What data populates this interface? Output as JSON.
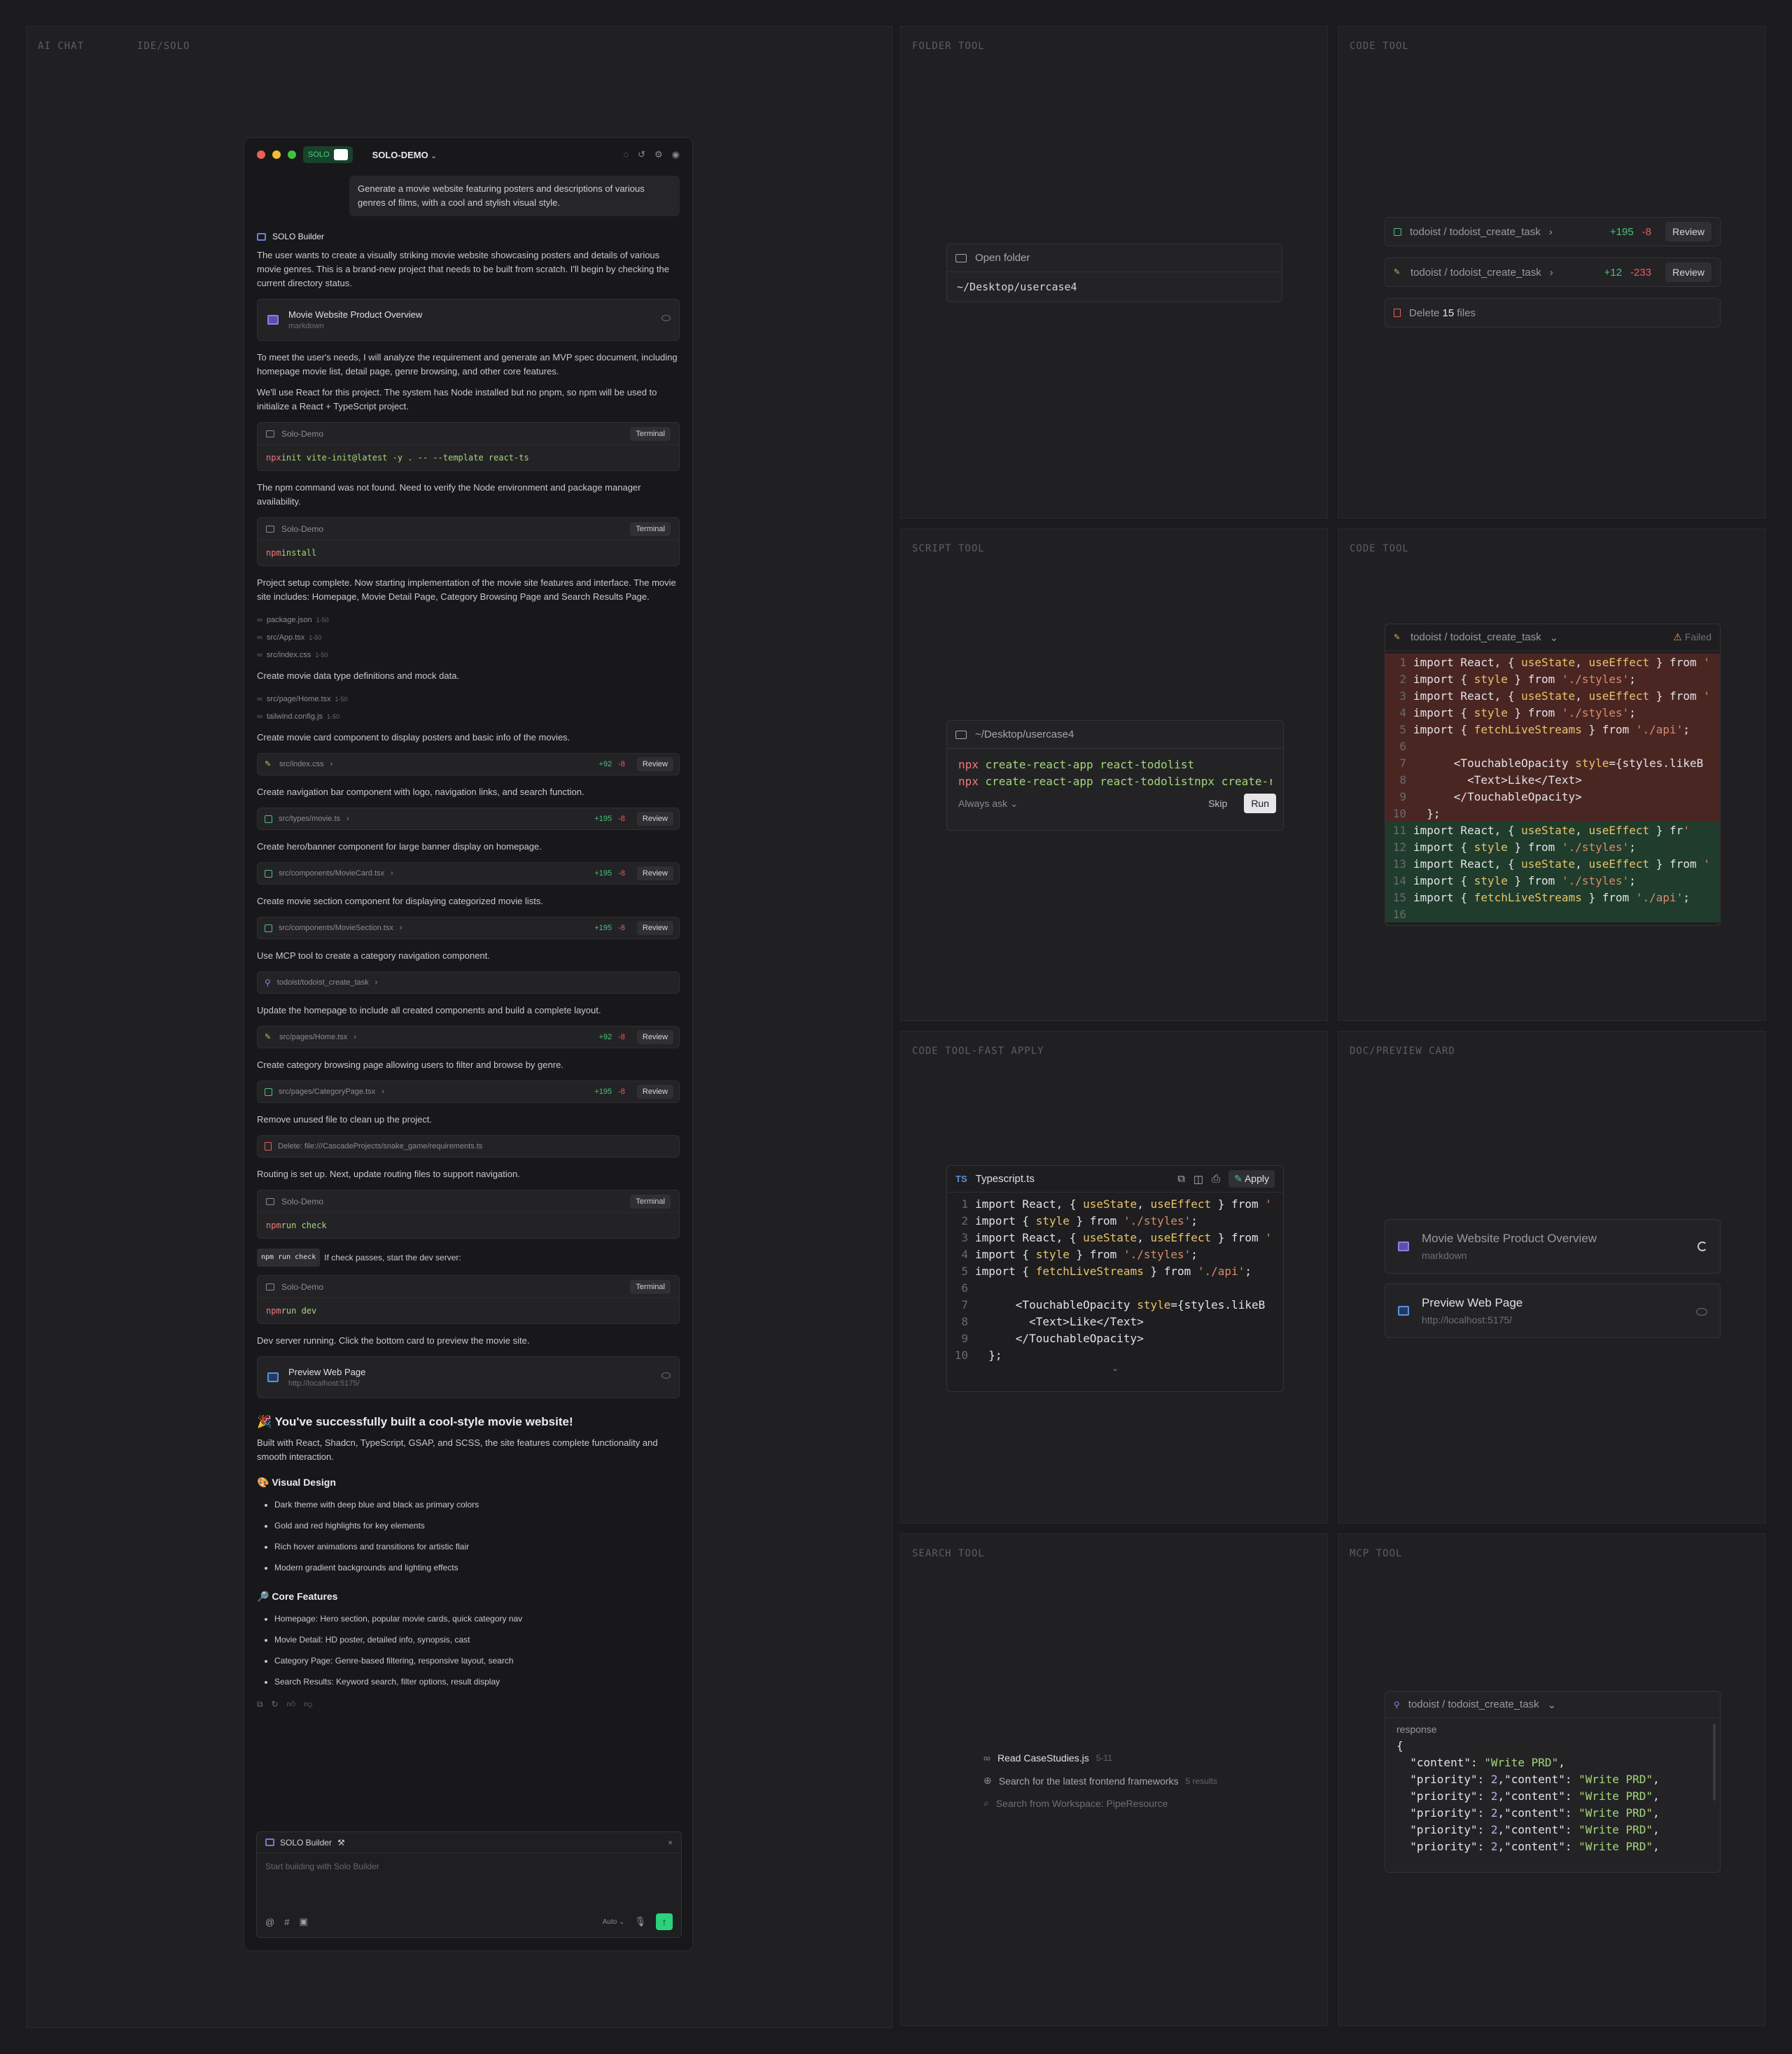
{
  "frames": {
    "ai_chat": "AI CHAT",
    "ide_solo": "IDE/SOLO",
    "folder_tool": "FOLDER TOOL",
    "code_tool_1": "CODE TOOL",
    "script_tool": "SCRIPT TOOL",
    "code_tool_2": "CODE TOOL",
    "code_fast_apply": "CODE TOOL-FAST APPLY",
    "doc_preview": "DOC/PREVIEW CARD",
    "search_tool": "SEARCH TOOL",
    "mcp_tool": "MCP TOOL"
  },
  "chat": {
    "pill": "SOLO",
    "project": "SOLO-DEMO",
    "user_message": "Generate a movie website featuring posters and descriptions of various genres of films, with a cool and stylish visual style.",
    "builder_name": "SOLO Builder",
    "p1": "The user wants to create a visually striking movie website showcasing posters and details of various movie genres. This is a brand-new project that needs to be built from scratch. I'll begin by checking the current directory status.",
    "doc_card": {
      "title": "Movie Website Product Overview",
      "sub": "markdown"
    },
    "p2": "To meet the user's needs, I will analyze the requirement and generate an MVP spec document, including homepage movie list, detail page, genre browsing, and other core features.",
    "p3": "We'll use React for this project. The system has Node installed but no pnpm, so npm will be used to initialize a React + TypeScript project.",
    "term1": {
      "name": "Solo-Demo",
      "btn": "Terminal",
      "cmd": "npx",
      "args": " init vite-init@latest -y . -- --template react-ts"
    },
    "p4": "The npm command was not found. Need to verify the Node environment and package manager availability.",
    "term2": {
      "name": "Solo-Demo",
      "btn": "Terminal",
      "cmd": "npm",
      "args": " install"
    },
    "p5": "Project setup complete. Now starting implementation of the movie site features and interface. The movie site includes: Homepage, Movie Detail Page, Category Browsing Page and Search Results Page.",
    "files1": [
      {
        "name": "package.json",
        "range": "1-50"
      },
      {
        "name": "src/App.tsx",
        "range": "1-50"
      },
      {
        "name": "src/index.css",
        "range": "1-50"
      }
    ],
    "p6": "Create movie data type definitions and mock data.",
    "files2": [
      {
        "name": "src/page/Home.tsx",
        "range": "1-50"
      },
      {
        "name": "tailwind.config.js",
        "range": "1-50"
      }
    ],
    "p7": "Create movie card component to display posters and basic info of the movies.",
    "fr1": {
      "path": "src/index.css",
      "plus": "+92",
      "minus": "-8",
      "btn": "Review"
    },
    "p8": "Create navigation bar component with logo, navigation links, and search function.",
    "fr2": {
      "path": "src/types/movie.ts",
      "plus": "+195",
      "minus": "-8",
      "btn": "Review"
    },
    "p9": "Create hero/banner component for large banner display on homepage.",
    "fr3": {
      "path": "src/components/MovieCard.tsx",
      "plus": "+195",
      "minus": "-8",
      "btn": "Review"
    },
    "p10": "Create movie section component for displaying categorized movie lists.",
    "fr4": {
      "path": "src/components/MovieSection.tsx",
      "plus": "+195",
      "minus": "-8",
      "btn": "Review"
    },
    "p11": "Use MCP tool to create a category navigation component.",
    "mcp_row": "todoist/todoist_create_task",
    "p12": "Update the homepage to include all created components and build a complete layout.",
    "fr5": {
      "path": "src/pages/Home.tsx",
      "plus": "+92",
      "minus": "-8",
      "btn": "Review"
    },
    "p13": "Create category browsing page allowing users to filter and browse by genre.",
    "fr6": {
      "path": "src/pages/CategoryPage.tsx",
      "plus": "+195",
      "minus": "-8",
      "btn": "Review"
    },
    "p14": "Remove unused file to clean up the project.",
    "del_row": "Delete: file:///CascadeProjects/snake_game/requirements.ts",
    "p15": "Routing is set up. Next, update routing files to support navigation.",
    "term3": {
      "name": "Solo-Demo",
      "btn": "Terminal",
      "cmd": "npm",
      "args": " run check"
    },
    "chip": "npm run check",
    "p16": "If check passes, start the dev server:",
    "term4": {
      "name": "Solo-Demo",
      "btn": "Terminal",
      "cmd": "npm",
      "args": " run dev"
    },
    "p17": "Dev server running. Click the bottom card to preview the movie site.",
    "preview": {
      "title": "Preview Web Page",
      "sub": "http://localhost:5175/"
    },
    "h_success": "🎉 You've successfully built a cool-style movie website!",
    "p18": "Built with React, Shadcn, TypeScript, GSAP, and SCSS, the site features complete functionality and smooth interaction.",
    "h_visual": "🎨 Visual Design",
    "visual": [
      "Dark theme with deep blue and black as primary colors",
      "Gold and red highlights for key elements",
      "Rich hover animations and transitions for artistic flair",
      "Modern gradient backgrounds and lighting effects"
    ],
    "h_core": "🔎 Core Features",
    "core": [
      "Homepage: Hero section, popular movie cards, quick category nav",
      "Movie Detail: HD poster, detailed info, synopsis, cast",
      "Category Page: Genre-based filtering, responsive layout, search",
      "Search Results: Keyword search, filter options, result display"
    ],
    "input": {
      "title": "SOLO Builder",
      "placeholder": "Start building with Solo Builder",
      "mode": "Auto"
    }
  },
  "folder": {
    "label": "Open folder",
    "path": "~/Desktop/usercase4"
  },
  "code1": {
    "rows": [
      {
        "path": "todoist / todoist_create_task",
        "plus": "+195",
        "minus": "-8",
        "btn": "Review"
      },
      {
        "path": "todoist / todoist_create_task",
        "plus": "+12",
        "minus": "-233",
        "btn": "Review"
      }
    ],
    "delete_prefix": "Delete ",
    "delete_count": "15",
    "delete_suffix": " files"
  },
  "script": {
    "path": "~/Desktop/usercase4",
    "line1_cmd": "npx",
    "line1_args": " create-react-app react-todolist",
    "line2_cmd": "npx",
    "line2_args": " create-react-app react-todolistnpx create-rea",
    "ask": "Always ask",
    "skip": "Skip",
    "run": "Run"
  },
  "code2": {
    "path": "todoist / todoist_create_task",
    "status": "Failed"
  },
  "fast_apply": {
    "lang": "TS",
    "file": "Typescript.ts",
    "apply": "Apply"
  },
  "doc_cards": [
    {
      "title": "Movie Website Product Overview",
      "sub": "markdown"
    },
    {
      "title": "Preview Web Page",
      "sub": "http://localhost:5175/"
    }
  ],
  "search": [
    {
      "text": "Read CaseStudies.js",
      "meta": "5-11"
    },
    {
      "text": "Search for the latest frontend frameworks",
      "meta": "5 results"
    },
    {
      "text": "Search from Workspace: PipeResource",
      "meta": ""
    }
  ],
  "mcp": {
    "path": "todoist / todoist_create_task",
    "label": "response"
  },
  "colors": {
    "accent": "#2bd27a",
    "added": "#4bc27c",
    "removed": "#e0605e",
    "bg": "#1b1b1d"
  }
}
